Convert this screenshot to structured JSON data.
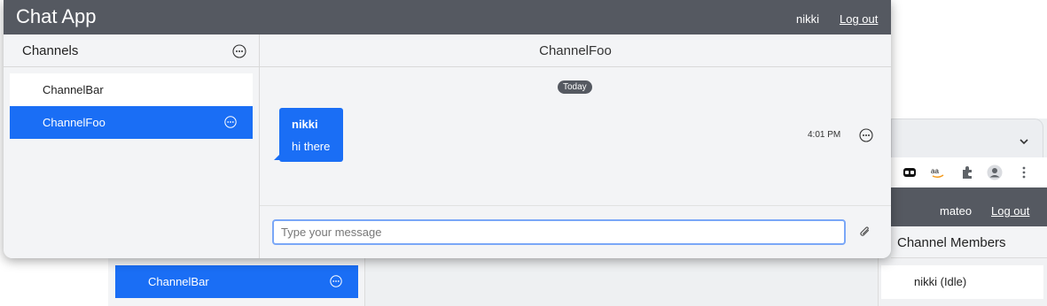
{
  "app": {
    "title": "Chat App",
    "username": "nikki",
    "logout_label": "Log out"
  },
  "sidebar": {
    "title": "Channels",
    "menu_icon": "more-circle-icon",
    "channels": [
      {
        "label": "ChannelBar",
        "active": false
      },
      {
        "label": "ChannelFoo",
        "active": true
      }
    ]
  },
  "main": {
    "channel_title": "ChannelFoo",
    "date_badge": "Today",
    "messages": [
      {
        "author": "nikki",
        "text": "hi there",
        "time": "4:01 PM"
      }
    ],
    "input": {
      "value": "",
      "placeholder": "Type your message"
    },
    "attach_icon": "paperclip-icon"
  },
  "background_window": {
    "username": "mateo",
    "logout_label": "Log out",
    "members_title": "Channel Members",
    "members": [
      "nikki (Idle)"
    ],
    "channels": [
      {
        "label": "ChannelBar",
        "active": true
      }
    ]
  },
  "colors": {
    "header": "#555961",
    "accent": "#1a6ef5",
    "panel": "#f3f4f6"
  }
}
